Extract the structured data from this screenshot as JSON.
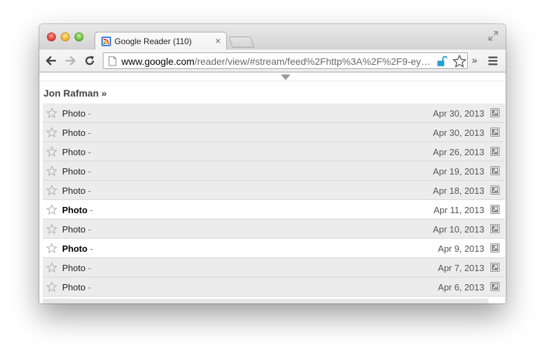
{
  "browser": {
    "tab_title": "Google Reader (110)",
    "tab_close": "×",
    "url_host": "www.google.com",
    "url_rest": "/reader/view/#stream/feed%2Fhttp%3A%2F%2F9-ey…",
    "overflow_chevron": "»"
  },
  "feed": {
    "title": "Jon Rafman »"
  },
  "entries": [
    {
      "title": "Photo",
      "dash": " -",
      "date": "Apr 30, 2013",
      "unread": false
    },
    {
      "title": "Photo",
      "dash": " -",
      "date": "Apr 30, 2013",
      "unread": false
    },
    {
      "title": "Photo",
      "dash": " -",
      "date": "Apr 26, 2013",
      "unread": false
    },
    {
      "title": "Photo",
      "dash": " -",
      "date": "Apr 19, 2013",
      "unread": false
    },
    {
      "title": "Photo",
      "dash": " -",
      "date": "Apr 18, 2013",
      "unread": false
    },
    {
      "title": "Photo",
      "dash": " -",
      "date": "Apr 11, 2013",
      "unread": true
    },
    {
      "title": "Photo",
      "dash": " -",
      "date": "Apr 10, 2013",
      "unread": false
    },
    {
      "title": "Photo",
      "dash": " -",
      "date": "Apr 9, 2013",
      "unread": true
    },
    {
      "title": "Photo",
      "dash": " -",
      "date": "Apr 7, 2013",
      "unread": false
    },
    {
      "title": "Photo",
      "dash": " -",
      "date": "Apr 6, 2013",
      "unread": false
    }
  ],
  "colors": {
    "read_row_bg": "#ececec",
    "unread_row_bg": "#ffffff",
    "lock_icon": "#2a9fd6"
  },
  "icons": [
    "reader-favicon",
    "back-arrow-icon",
    "forward-arrow-icon",
    "reload-icon",
    "page-icon",
    "lock-open-icon",
    "star-icon",
    "hamburger-menu-icon",
    "external-link-icon",
    "fullscreen-icon"
  ]
}
